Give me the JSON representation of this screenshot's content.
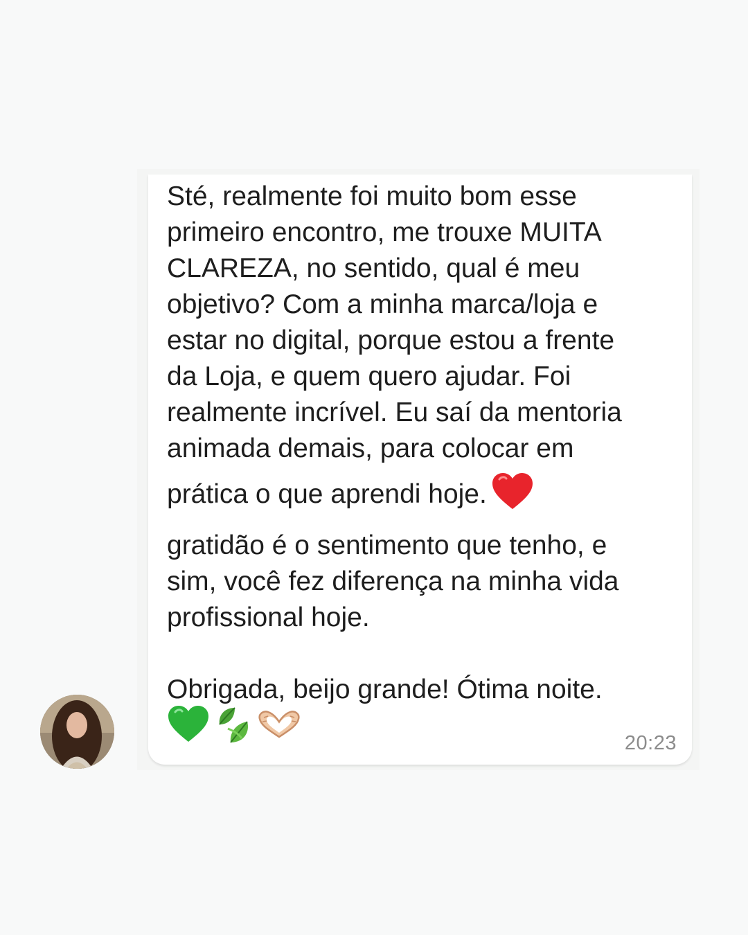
{
  "message": {
    "lines": [
      "Sté, realmente foi muito bom esse",
      "primeiro encontro, me trouxe MUITA",
      "CLAREZA, no sentido, qual é meu",
      "objetivo? Com a minha marca/loja e",
      "estar no digital, porque estou a frente",
      "da Loja, e quem quero ajudar. Foi",
      "realmente incrível. Eu saí da mentoria",
      "animada demais, para colocar em",
      "prática o que aprendi hoje.",
      "gratidão é o sentimento que tenho, e",
      "sim, você fez diferença na minha vida",
      "profissional hoje.",
      "",
      "Obrigada, beijo grande! Ótima noite."
    ],
    "inline_emoji": "red-heart-icon",
    "trailing_emojis": [
      "green-heart-icon",
      "leaves-icon",
      "heart-hands-icon"
    ],
    "time": "20:23"
  },
  "colors": {
    "page_background": "#f8f9f9",
    "bubble_background": "#ffffff",
    "text": "#1e1e1e",
    "time": "#8c8c8c",
    "red_heart": "#e8242c",
    "green_heart": "#2bb33a"
  }
}
